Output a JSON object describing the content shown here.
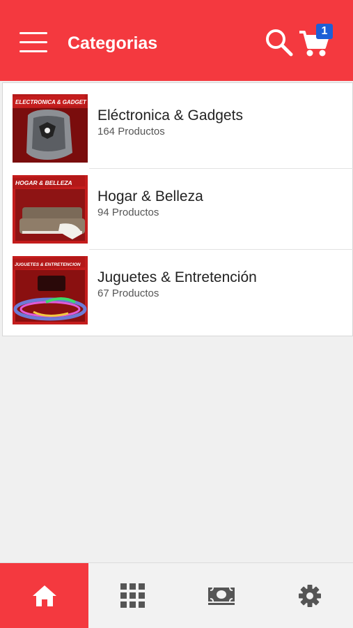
{
  "appbar": {
    "title": "Categorias",
    "cart_count": "1"
  },
  "categories": [
    {
      "banner": "ELECTRONICA & GADGET",
      "name": "Eléctronica & Gadgets",
      "count": "164 Productos"
    },
    {
      "banner": "HOGAR & BELLEZA",
      "name": "Hogar & Belleza",
      "count": "94 Productos"
    },
    {
      "banner": "JUGUETES & ENTRETENCION",
      "name": "Juguetes & Entretención",
      "count": "67 Productos"
    }
  ],
  "tabbar": {
    "icons": [
      "home-icon",
      "grid-icon",
      "money-icon",
      "settings-icon"
    ],
    "active_index": 0
  },
  "colors": {
    "brand_red": "#f4393f",
    "badge_blue": "#1e5fd6"
  }
}
